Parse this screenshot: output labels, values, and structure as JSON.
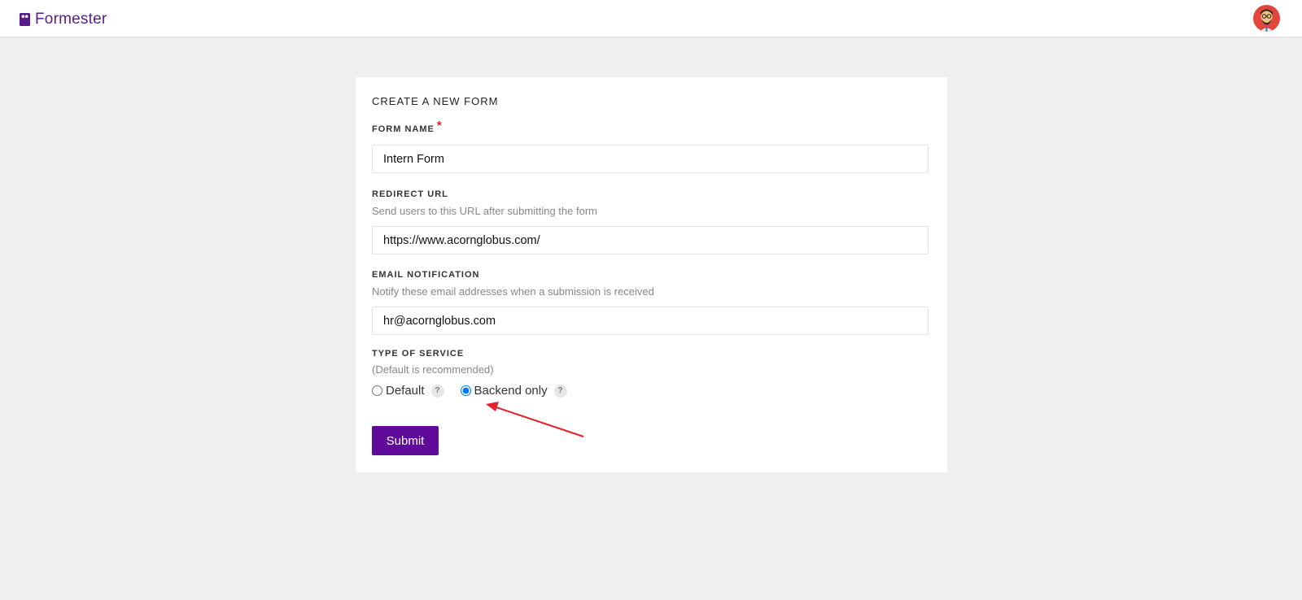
{
  "header": {
    "app_name": "Formester"
  },
  "form": {
    "title": "CREATE A NEW FORM",
    "name_label": "FORM NAME",
    "name_required": "*",
    "name_value": "Intern Form",
    "redirect_label": "REDIRECT URL",
    "redirect_help": "Send users to this URL after submitting the form",
    "redirect_value": "https://www.acornglobus.com/",
    "email_label": "EMAIL NOTIFICATION",
    "email_help": "Notify these email addresses when a submission is received",
    "email_value": "hr@acornglobus.com",
    "service_label": "TYPE OF SERVICE",
    "service_help": "(Default is recommended)",
    "service_options": [
      {
        "label": "Default",
        "selected": false
      },
      {
        "label": "Backend only",
        "selected": true
      }
    ],
    "help_glyph": "?",
    "submit_label": "Submit"
  },
  "colors": {
    "brand": "#5f0a99",
    "annotation_arrow": "#e8202a"
  },
  "icons": {
    "logo": "formester-logo-icon",
    "avatar": "user-avatar",
    "help": "question-icon"
  }
}
